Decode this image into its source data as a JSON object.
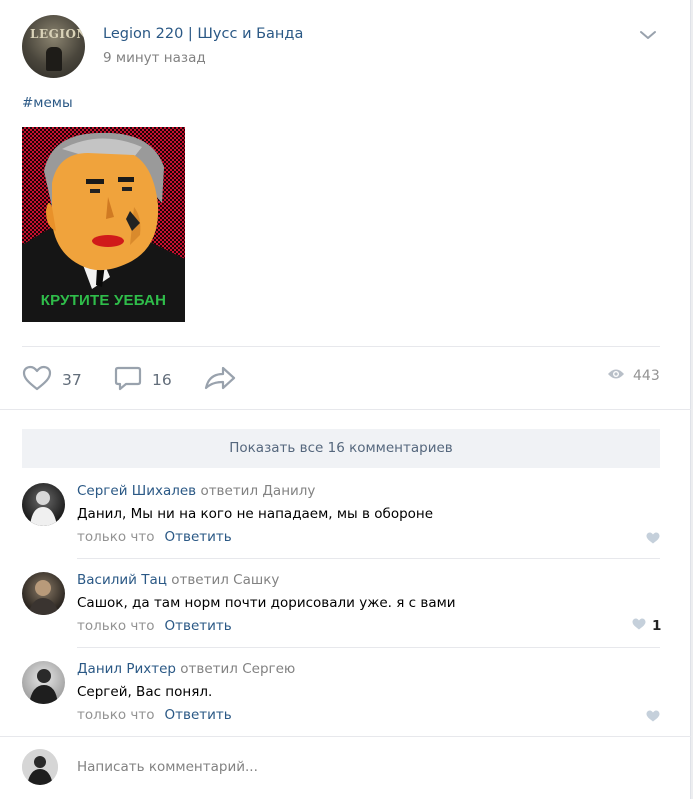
{
  "post": {
    "group_name": "Legion 220 | Шусс и Банда",
    "group_logo_text": "LEGION",
    "time": "9 минут назад",
    "hashtag": "#мемы",
    "image_caption": "КРУТИТЕ УЕБАН",
    "likes": "37",
    "comments": "16",
    "views": "443",
    "icons": {
      "menu": "chevron-down-icon",
      "like": "heart-icon",
      "comment": "comment-icon",
      "share": "share-arrow-icon",
      "views": "eye-icon"
    }
  },
  "show_all_label": "Показать все 16 комментариев",
  "comments": [
    {
      "author": "Сергей Шихалев",
      "reply_to": "ответил Данилу",
      "text": "Данил, Мы ни на кого не нападаем, мы в обороне",
      "time": "только что",
      "reply_label": "Ответить",
      "likes": ""
    },
    {
      "author": "Василий Тац",
      "reply_to": "ответил Сашку",
      "text": "Сашок, да там норм почти дорисовали уже. я с вами",
      "time": "только что",
      "reply_label": "Ответить",
      "likes": "1"
    },
    {
      "author": "Данил Рихтер",
      "reply_to": "ответил Сергею",
      "text": "Сергей, Вас понял.",
      "time": "только что",
      "reply_label": "Ответить",
      "likes": ""
    }
  ],
  "composer": {
    "placeholder": "Написать комментарий..."
  },
  "colors": {
    "link": "#2a5885",
    "muted": "#828282",
    "icon": "#99a2ad",
    "meme_background": "#c8102e",
    "meme_caption": "#2fbd4a"
  }
}
